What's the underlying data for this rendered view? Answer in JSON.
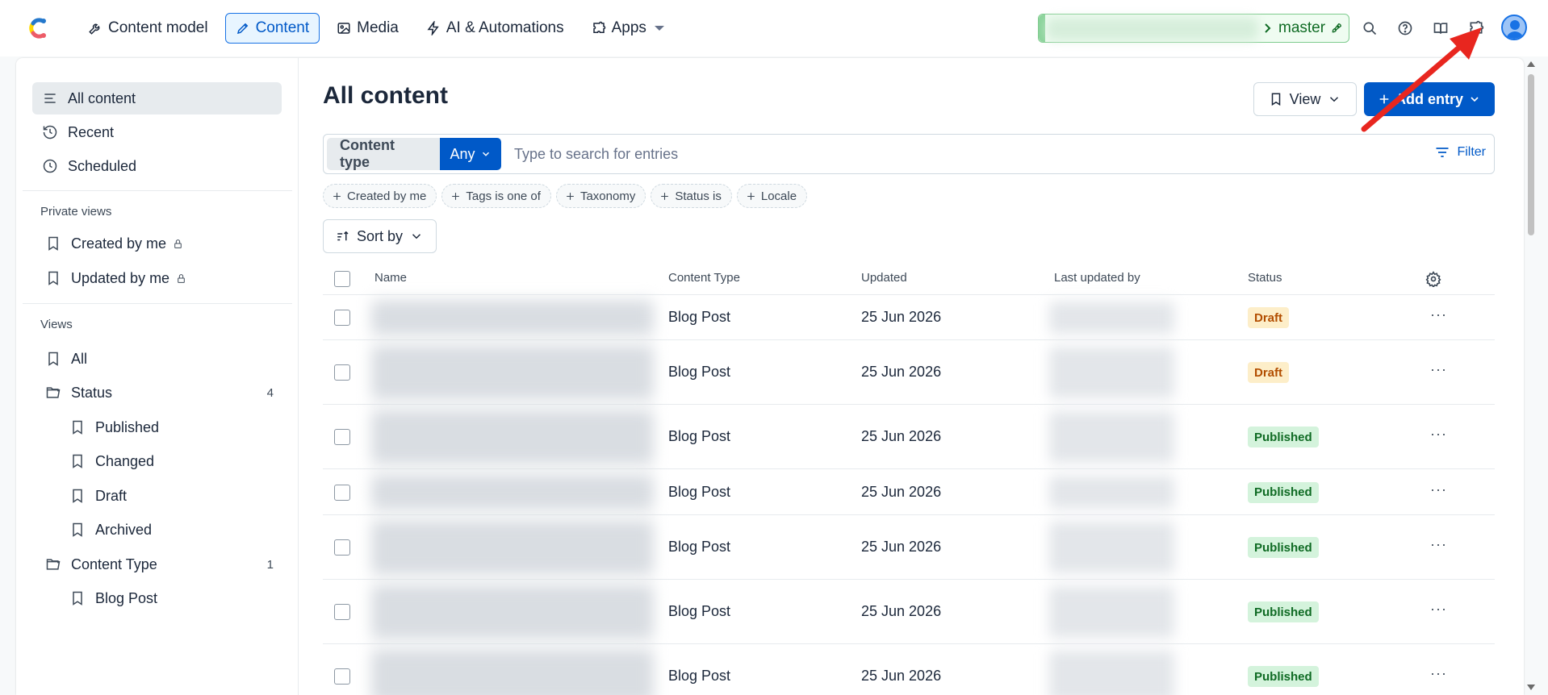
{
  "topbar": {
    "nav": [
      {
        "label": "Content model",
        "icon": "wrench-icon"
      },
      {
        "label": "Content",
        "icon": "pen-icon"
      },
      {
        "label": "Media",
        "icon": "image-icon"
      },
      {
        "label": "AI & Automations",
        "icon": "bolt-icon"
      },
      {
        "label": "Apps",
        "icon": "puzzle-icon"
      }
    ],
    "environment": "master"
  },
  "sidebar": {
    "primary": [
      {
        "label": "All content"
      },
      {
        "label": "Recent"
      },
      {
        "label": "Scheduled"
      }
    ],
    "private_heading": "Private views",
    "private": [
      {
        "label": "Created by me"
      },
      {
        "label": "Updated by me"
      }
    ],
    "views_heading": "Views",
    "views": {
      "all": "All",
      "status": {
        "label": "Status",
        "count": "4"
      },
      "status_items": [
        {
          "label": "Published"
        },
        {
          "label": "Changed"
        },
        {
          "label": "Draft"
        },
        {
          "label": "Archived"
        }
      ],
      "content_type": {
        "label": "Content Type",
        "count": "1"
      },
      "content_type_items": [
        {
          "label": "Blog Post"
        }
      ]
    }
  },
  "main": {
    "title": "All content",
    "view_button": "View",
    "add_button": "Add entry",
    "search": {
      "content_type_label": "Content type",
      "content_type_value": "Any",
      "placeholder": "Type to search for entries",
      "filter_label": "Filter"
    },
    "chips": [
      {
        "label": "Created by me"
      },
      {
        "label": "Tags is one of"
      },
      {
        "label": "Taxonomy"
      },
      {
        "label": "Status is"
      },
      {
        "label": "Locale"
      }
    ],
    "sort_label": "Sort by",
    "table": {
      "columns": [
        "Name",
        "Content Type",
        "Updated",
        "Last updated by",
        "Status"
      ],
      "rows": [
        {
          "content_type": "Blog Post",
          "updated": "25 Jun 2026",
          "status": "Draft"
        },
        {
          "content_type": "Blog Post",
          "updated": "25 Jun 2026",
          "status": "Draft"
        },
        {
          "content_type": "Blog Post",
          "updated": "25 Jun 2026",
          "status": "Published"
        },
        {
          "content_type": "Blog Post",
          "updated": "25 Jun 2026",
          "status": "Published"
        },
        {
          "content_type": "Blog Post",
          "updated": "25 Jun 2026",
          "status": "Published"
        },
        {
          "content_type": "Blog Post",
          "updated": "25 Jun 2026",
          "status": "Published"
        },
        {
          "content_type": "Blog Post",
          "updated": "25 Jun 2026",
          "status": "Published"
        }
      ],
      "row_menu": "···"
    }
  },
  "colors": {
    "primary": "#0059c8",
    "draft_bg": "#fdeec9",
    "published_bg": "#d4f3dc",
    "annotation_arrow": "#e8261f"
  }
}
